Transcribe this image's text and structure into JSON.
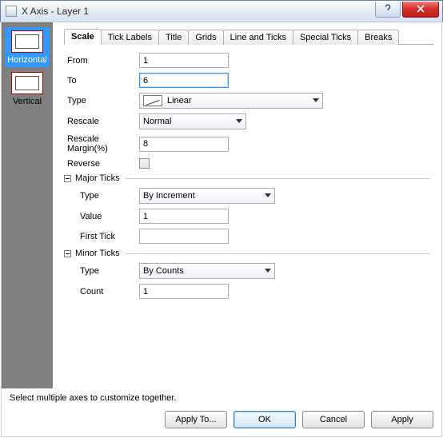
{
  "window": {
    "title": "X Axis - Layer 1"
  },
  "sidebar": {
    "items": [
      {
        "label": "Horizontal",
        "selected": true
      },
      {
        "label": "Vertical",
        "selected": false
      }
    ]
  },
  "tabs": [
    "Scale",
    "Tick Labels",
    "Title",
    "Grids",
    "Line and Ticks",
    "Special Ticks",
    "Breaks"
  ],
  "activeTab": "Scale",
  "scale": {
    "fromLabel": "From",
    "toLabel": "To",
    "typeLabel": "Type",
    "rescaleLabel": "Rescale",
    "rescaleMarginLabel": "Rescale Margin(%)",
    "reverseLabel": "Reverse",
    "from": "1",
    "to": "6",
    "type": "Linear",
    "rescale": "Normal",
    "rescaleMargin": "8",
    "reverse": false,
    "majorTicks": {
      "groupLabel": "Major Ticks",
      "typeLabel": "Type",
      "valueLabel": "Value",
      "firstTickLabel": "First Tick",
      "type": "By Increment",
      "value": "1",
      "firstTick": ""
    },
    "minorTicks": {
      "groupLabel": "Minor Ticks",
      "typeLabel": "Type",
      "countLabel": "Count",
      "type": "By Counts",
      "count": "1"
    }
  },
  "footer": {
    "hint": "Select multiple axes to customize together.",
    "applyTo": "Apply To...",
    "ok": "OK",
    "cancel": "Cancel",
    "apply": "Apply"
  }
}
